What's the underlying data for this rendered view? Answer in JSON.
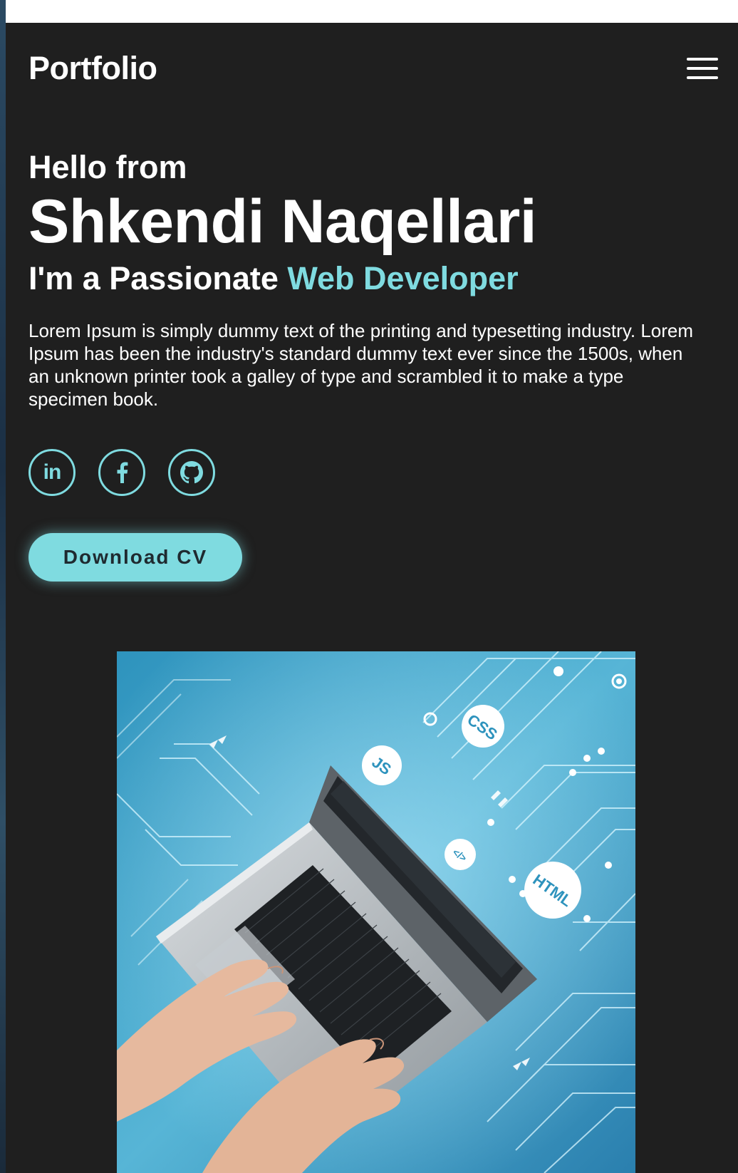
{
  "navbar": {
    "logo": "Portfolio",
    "menu_icon": "hamburger-menu-icon"
  },
  "hero": {
    "greeting": "Hello from",
    "name": "Shkendi Naqellari",
    "role_prefix": "I'm a Passionate ",
    "role_highlight": "Web Developer",
    "bio": "Lorem Ipsum is simply dummy text of the printing and typesetting industry. Lorem Ipsum has been the industry's standard dummy text ever since the 1500s, when an unknown printer took a galley of type and scrambled it to make a type specimen book.",
    "socials": [
      {
        "icon": "linkedin-icon",
        "glyph": "in"
      },
      {
        "icon": "facebook-icon",
        "glyph": "f"
      },
      {
        "icon": "github-icon"
      }
    ],
    "cta_label": "Download CV"
  },
  "image": {
    "badges": [
      "CSS",
      "JS",
      "HTML",
      "</>"
    ]
  },
  "colors": {
    "background": "#1f1f1f",
    "accent": "#7fdbe0",
    "text": "#ffffff"
  }
}
